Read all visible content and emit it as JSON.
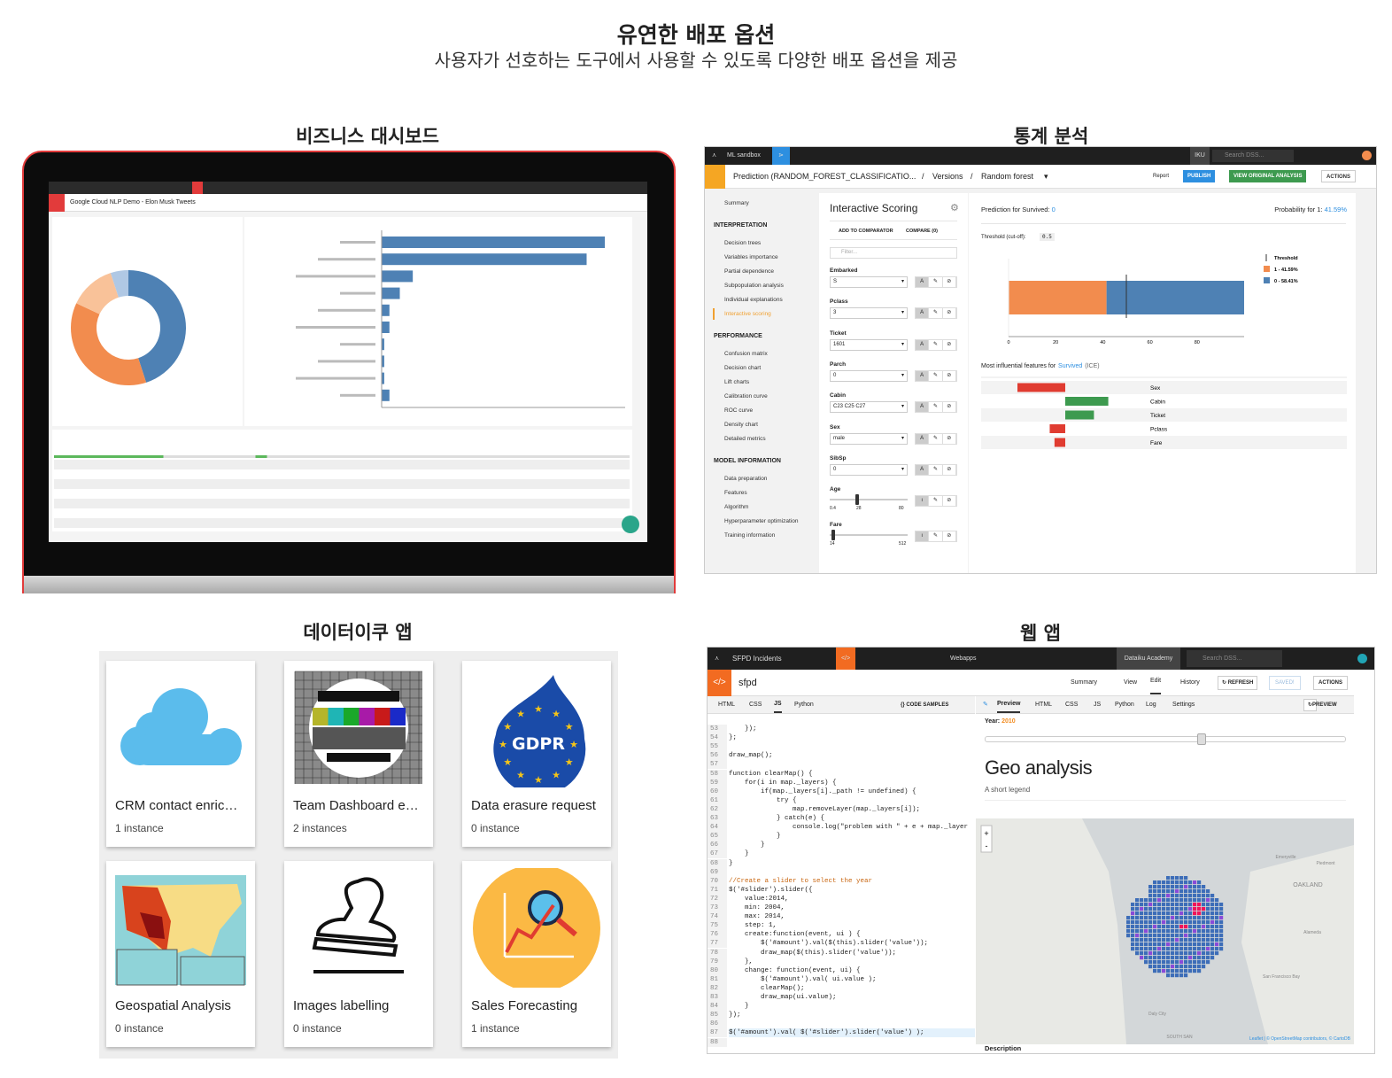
{
  "header": {
    "title": "유연한 배포 옵션",
    "subtitle": "사용자가 선호하는 도구에서 사용할 수 있도록 다양한 배포 옵션을 제공"
  },
  "sections": {
    "dashboard": "비즈니스 대시보드",
    "stats": "통계 분석",
    "apps": "데이터이쿠 앱",
    "webapp": "웹 앱"
  },
  "dashboard": {
    "title": "Google Cloud NLP Demo - Elon Musk Tweets",
    "donut_colors": [
      "#4e81b4",
      "#f28c4e",
      "#f9c299",
      "#b0c8e4"
    ],
    "donut_shares": [
      45,
      37,
      13,
      5
    ],
    "bar_values": [
      86,
      79,
      12,
      7,
      3,
      3,
      1,
      1,
      1,
      3
    ],
    "accent": "#e23b3b"
  },
  "stats": {
    "topbar": {
      "project": "ML sandbox",
      "user": "IKU",
      "search_placeholder": "Search DSS..."
    },
    "breadcrumb": [
      "Prediction (RANDOM_FOREST_CLASSIFICATIO...",
      "/",
      "Versions",
      "/",
      "Random forest"
    ],
    "tabs": {
      "report": "Report",
      "publish": "PUBLISH",
      "view": "VIEW ORIGINAL ANALYSIS",
      "actions": "ACTIONS"
    },
    "nav": {
      "summary": "Summary",
      "groups": [
        {
          "title": "INTERPRETATION",
          "items": [
            "Decision trees",
            "Variables importance",
            "Partial dependence",
            "Subpopulation analysis",
            "Individual explanations",
            "Interactive scoring"
          ]
        },
        {
          "title": "PERFORMANCE",
          "items": [
            "Confusion matrix",
            "Decision chart",
            "Lift charts",
            "Calibration curve",
            "ROC curve",
            "Density chart",
            "Detailed metrics"
          ]
        },
        {
          "title": "MODEL INFORMATION",
          "items": [
            "Data preparation",
            "Features",
            "Algorithm",
            "Hyperparameter optimization",
            "Training information"
          ]
        }
      ],
      "active": "Interactive scoring"
    },
    "scoring": {
      "title": "Interactive Scoring",
      "add": "ADD TO COMPARATOR",
      "compare": "COMPARE (0)",
      "filter_placeholder": "Filter...",
      "fields": [
        {
          "label": "Embarked",
          "value": "S"
        },
        {
          "label": "Pclass",
          "value": "3"
        },
        {
          "label": "Ticket",
          "value": "1601"
        },
        {
          "label": "Parch",
          "value": "0"
        },
        {
          "label": "Cabin",
          "value": "C23 C25 C27"
        },
        {
          "label": "Sex",
          "value": "male"
        },
        {
          "label": "SibSp",
          "value": "0"
        }
      ],
      "age": {
        "label": "Age",
        "min": "0.4",
        "value": "28",
        "max": "80",
        "fraction": 0.35
      },
      "fare": {
        "label": "Fare",
        "min": "14",
        "max": "512",
        "fraction": 0.02
      }
    },
    "result": {
      "prediction_label": "Prediction for Survived:",
      "prediction": "0",
      "prob_label": "Probability for 1:",
      "prob": "41.59%",
      "threshold_label": "Threshold (cut-off):",
      "threshold": "0.5",
      "legend": [
        "Threshold",
        "1 - 41.59%",
        "0 - 58.41%"
      ],
      "p1": 41.59,
      "ticks": [
        "0",
        "20",
        "40",
        "60",
        "80"
      ],
      "ice_title_a": "Most influential features for",
      "ice_title_b": "Survived",
      "ice_title_c": "(ICE)",
      "ice": [
        {
          "name": "Sex",
          "value": -20
        },
        {
          "name": "Cabin",
          "value": 18
        },
        {
          "name": "Ticket",
          "value": 12
        },
        {
          "name": "Pclass",
          "value": -6.5
        },
        {
          "name": "Fare",
          "value": -4.5
        }
      ],
      "colors": {
        "orange": "#f28c4e",
        "blue": "#4e81b4",
        "red": "#e03c31",
        "green": "#3d9a4f",
        "link": "#2d8fe0"
      }
    }
  },
  "apps": [
    {
      "title": "CRM contact enric…",
      "sub": "1 instance",
      "icon": "cloud"
    },
    {
      "title": "Team Dashboard e…",
      "sub": "2 instances",
      "icon": "test-card"
    },
    {
      "title": "Data erasure request",
      "sub": "0 instance",
      "icon": "gdpr",
      "badge": "GDPR"
    },
    {
      "title": "Geospatial Analysis",
      "sub": "0 instance",
      "icon": "us-map"
    },
    {
      "title": "Images labelling",
      "sub": "0 instance",
      "icon": "stamp"
    },
    {
      "title": "Sales Forecasting",
      "sub": "1 instance",
      "icon": "chart-magnifier"
    }
  ],
  "webapp": {
    "project": "SFPD Incidents",
    "section": "Webapps",
    "academy": "Dataiku Academy",
    "search_placeholder": "Search DSS...",
    "name": "sfpd",
    "header_tabs": [
      "Summary",
      "View",
      "Edit",
      "History"
    ],
    "refresh": "REFRESH",
    "saved": "SAVED!",
    "actions": "ACTIONS",
    "code_tabs": [
      "HTML",
      "CSS",
      "JS",
      "Python"
    ],
    "code_samples": "{} CODE SAMPLES",
    "preview_tabs": [
      "Preview",
      "HTML",
      "CSS",
      "JS",
      "Python",
      "Log",
      "Settings"
    ],
    "preview_btn": "PREVIEW",
    "year_label": "Year:",
    "year": "2010",
    "slider_fraction": 0.6,
    "heading": "Geo analysis",
    "legend": "A short legend",
    "description": "Description",
    "map_labels": [
      "Emeryville",
      "Piedmont",
      "OAKLAND",
      "Alameda",
      "San Francisco Bay",
      "Daly City",
      "SOUTH SAN"
    ],
    "attribution": "Leaflet | © OpenStreetMap contributors, © CartoDB",
    "code_start": 53,
    "code": [
      "    });",
      "};",
      "",
      "draw_map();",
      "",
      "function clearMap() {",
      "    for(i in map._layers) {",
      "        if(map._layers[i]._path != undefined) {",
      "            try {",
      "                map.removeLayer(map._layers[i]);",
      "            } catch(e) {",
      "                console.log(\"problem with \" + e + map._layer",
      "            }",
      "        }",
      "    }",
      "}",
      "",
      "//Create a slider to select the year",
      "$('#slider').slider({",
      "    value:2014,",
      "    min: 2004,",
      "    max: 2014,",
      "    step: 1,",
      "    create:function(event, ui ) {",
      "        $('#amount').val($(this).slider('value'));",
      "        draw_map($(this).slider('value'));",
      "    },",
      "    change: function(event, ui) {",
      "        $('#amount').val( ui.value );",
      "        clearMap();",
      "        draw_map(ui.value);",
      "    }",
      "});",
      "",
      "$('#amount').val( $('#slider').slider('value') );",
      ""
    ]
  }
}
